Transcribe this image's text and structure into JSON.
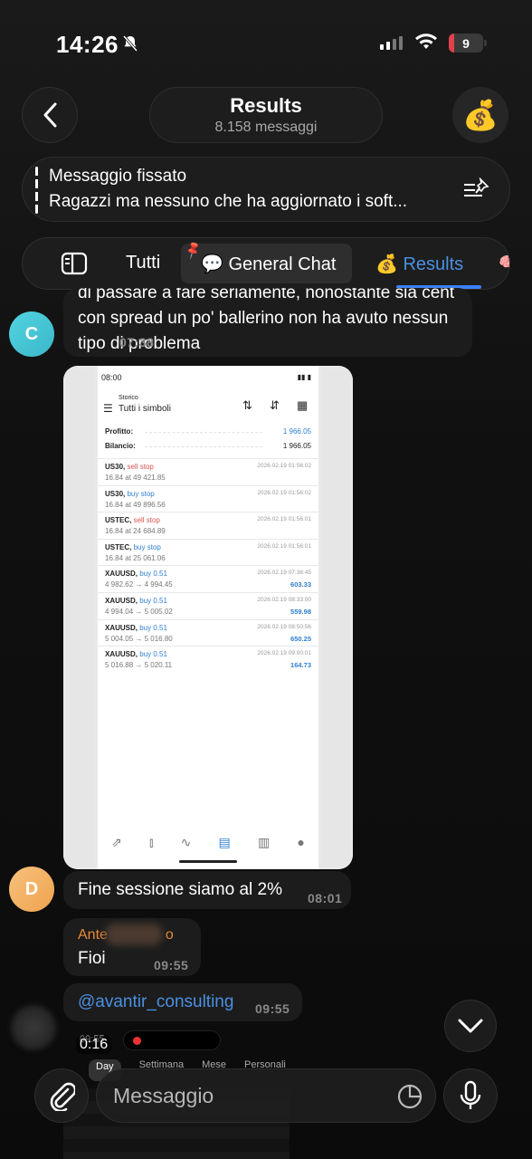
{
  "status_bar": {
    "time": "14:26",
    "battery": "9"
  },
  "header": {
    "title": "Results",
    "subtitle": "8.158 messaggi",
    "avatar_emoji": "💰"
  },
  "pinned": {
    "label": "Messaggio fissato",
    "text": "Ragazzi ma nessuno che ha aggiornato i soft..."
  },
  "topics": {
    "tutti": "Tutti",
    "general": "💬 General Chat",
    "results": "💰 Results",
    "active_color": "#4a90e2"
  },
  "messages": [
    {
      "avatar": "C",
      "text": "di passare a fare seriamente, nonostante sia cent con spread un po' ballerino non ha avuto nessun tipo di problema",
      "time": "07:38"
    },
    {
      "avatar": "D",
      "text": "Fine sessione siamo al 2%",
      "time": "08:01"
    },
    {
      "author": "Ante",
      "author_suffix": "o",
      "text": "Fioi",
      "time": "09:55"
    },
    {
      "text": "@avantir_consulting",
      "time": "09:55"
    }
  ],
  "screenshot": {
    "status_time": "08:00",
    "title_small": "Storico",
    "title": "Tutti i simboli",
    "profit_label": "Profitto:",
    "profit_value": "1 966.05",
    "balance_label": "Bilancio:",
    "balance_value": "1 966.05",
    "trades": [
      {
        "sym": "US30,",
        "type": "sell stop",
        "kind": "sell",
        "detail": "16.84 at 49 421.85",
        "date": "2026.02.19 01:56:02",
        "profit": ""
      },
      {
        "sym": "US30,",
        "type": "buy stop",
        "kind": "buy",
        "detail": "16.84 at 49 896.56",
        "date": "2026.02.19 01:56:02",
        "profit": ""
      },
      {
        "sym": "USTEC,",
        "type": "sell stop",
        "kind": "sell",
        "detail": "16.84 at 24 684.89",
        "date": "2026.02.19 01:56:01",
        "profit": ""
      },
      {
        "sym": "USTEC,",
        "type": "buy stop",
        "kind": "buy",
        "detail": "16.84 at 25 061.06",
        "date": "2026.02.19 01:56:01",
        "profit": ""
      },
      {
        "sym": "XAUUSD,",
        "type": "buy 0.51",
        "kind": "buy",
        "detail": "4 982.62 → 4 994.45",
        "date": "2026.02.19 07:38:45",
        "profit": "603.33"
      },
      {
        "sym": "XAUUSD,",
        "type": "buy 0.51",
        "kind": "buy",
        "detail": "4 994.04 → 5 005.02",
        "date": "2026.02.19 08:33:00",
        "profit": "559.98"
      },
      {
        "sym": "XAUUSD,",
        "type": "buy 0.51",
        "kind": "buy",
        "detail": "5 004.05 → 5 016.80",
        "date": "2026.02.19 08:50:56",
        "profit": "650.25"
      },
      {
        "sym": "XAUUSD,",
        "type": "buy 0.51",
        "kind": "buy",
        "detail": "5 016.88 → 5 020.11",
        "date": "2026.02.19 09:00:01",
        "profit": "164.73"
      }
    ]
  },
  "video": {
    "duration": "0:16",
    "time": "09:55",
    "tabs": [
      "Day",
      "Settimana",
      "Mese",
      "Personali"
    ]
  },
  "composer": {
    "placeholder": "Messaggio"
  }
}
